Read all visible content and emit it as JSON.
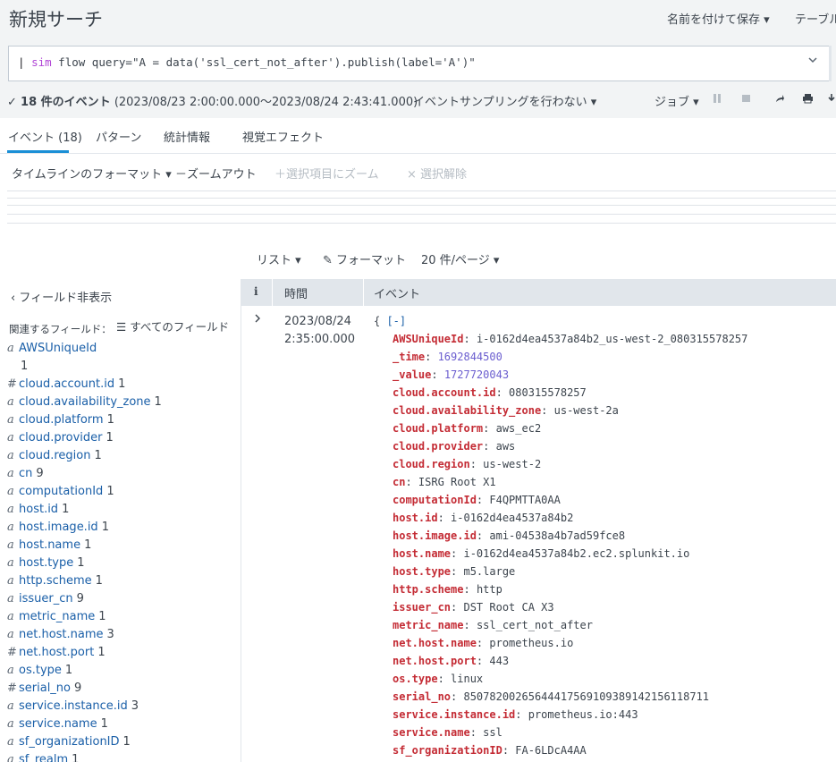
{
  "header": {
    "title": "新規サーチ",
    "save_as": "名前を付けて保存 ▾",
    "table": "テーブル"
  },
  "search": {
    "pipe": "|",
    "command": "sim",
    "rest": " flow query=\"A = data('ssl_cert_not_after').publish(label='A')\""
  },
  "status": {
    "count": "18 件のイベント",
    "range": "(2023/08/23 2:00:00.000〜2023/08/24 2:43:41.000)",
    "sampling": "イベントサンプリングを行わない ▾",
    "job": "ジョブ ▾"
  },
  "tabs": [
    {
      "label": "イベント (18)"
    },
    {
      "label": "パターン"
    },
    {
      "label": "統計情報"
    },
    {
      "label": "視覚エフェクト"
    }
  ],
  "timeline": {
    "format": "タイムラインのフォーマット ▾",
    "zoom_out": "－ズームアウト",
    "zoom_selection": "＋選択項目にズーム",
    "deselect": "× 選択解除"
  },
  "options": {
    "list": "リスト ▾",
    "format": "フォーマット",
    "per_page": "20 件/ページ ▾"
  },
  "sidebar": {
    "hide_fields": "フィールド非表示",
    "related_label": "関連するフィールド：",
    "all_fields": "すべてのフィールド",
    "fields": [
      {
        "type": "a",
        "name": "AWSUniqueId",
        "count": "1",
        "wrap": true
      },
      {
        "type": "#",
        "name": "cloud.account.id",
        "count": "1"
      },
      {
        "type": "a",
        "name": "cloud.availability_zone",
        "count": "1"
      },
      {
        "type": "a",
        "name": "cloud.platform",
        "count": "1"
      },
      {
        "type": "a",
        "name": "cloud.provider",
        "count": "1"
      },
      {
        "type": "a",
        "name": "cloud.region",
        "count": "1"
      },
      {
        "type": "a",
        "name": "cn",
        "count": "9"
      },
      {
        "type": "a",
        "name": "computationId",
        "count": "1"
      },
      {
        "type": "a",
        "name": "host.id",
        "count": "1"
      },
      {
        "type": "a",
        "name": "host.image.id",
        "count": "1"
      },
      {
        "type": "a",
        "name": "host.name",
        "count": "1"
      },
      {
        "type": "a",
        "name": "host.type",
        "count": "1"
      },
      {
        "type": "a",
        "name": "http.scheme",
        "count": "1"
      },
      {
        "type": "a",
        "name": "issuer_cn",
        "count": "9"
      },
      {
        "type": "a",
        "name": "metric_name",
        "count": "1"
      },
      {
        "type": "a",
        "name": "net.host.name",
        "count": "3"
      },
      {
        "type": "#",
        "name": "net.host.port",
        "count": "1"
      },
      {
        "type": "a",
        "name": "os.type",
        "count": "1"
      },
      {
        "type": "#",
        "name": "serial_no",
        "count": "9"
      },
      {
        "type": "a",
        "name": "service.instance.id",
        "count": "3"
      },
      {
        "type": "a",
        "name": "service.name",
        "count": "1"
      },
      {
        "type": "a",
        "name": "sf_organizationID",
        "count": "1"
      },
      {
        "type": "a",
        "name": "sf_realm",
        "count": "1"
      }
    ]
  },
  "table": {
    "col_info": "i",
    "col_time": "時間",
    "col_event": "イベント"
  },
  "event": {
    "date": "2023/08/24",
    "time": "2:35:00.000",
    "open": "{ ",
    "toggle": "[-]",
    "pairs": [
      {
        "k": "AWSUniqueId",
        "v": "i-0162d4ea4537a84b2_us-west-2_080315578257",
        "num": false
      },
      {
        "k": "_time",
        "v": "1692844500",
        "num": true
      },
      {
        "k": "_value",
        "v": "1727720043",
        "num": true
      },
      {
        "k": "cloud.account.id",
        "v": "080315578257",
        "num": false
      },
      {
        "k": "cloud.availability_zone",
        "v": "us-west-2a",
        "num": false
      },
      {
        "k": "cloud.platform",
        "v": "aws_ec2",
        "num": false
      },
      {
        "k": "cloud.provider",
        "v": "aws",
        "num": false
      },
      {
        "k": "cloud.region",
        "v": "us-west-2",
        "num": false
      },
      {
        "k": "cn",
        "v": "ISRG Root X1",
        "num": false
      },
      {
        "k": "computationId",
        "v": "F4QPMTTA0AA",
        "num": false
      },
      {
        "k": "host.id",
        "v": "i-0162d4ea4537a84b2",
        "num": false
      },
      {
        "k": "host.image.id",
        "v": "ami-04538a4b7ad59fce8",
        "num": false
      },
      {
        "k": "host.name",
        "v": "i-0162d4ea4537a84b2.ec2.splunkit.io",
        "num": false
      },
      {
        "k": "host.type",
        "v": "m5.large",
        "num": false
      },
      {
        "k": "http.scheme",
        "v": "http",
        "num": false
      },
      {
        "k": "issuer_cn",
        "v": "DST Root CA X3",
        "num": false
      },
      {
        "k": "metric_name",
        "v": "ssl_cert_not_after",
        "num": false
      },
      {
        "k": "net.host.name",
        "v": "prometheus.io",
        "num": false
      },
      {
        "k": "net.host.port",
        "v": "443",
        "num": false
      },
      {
        "k": "os.type",
        "v": "linux",
        "num": false
      },
      {
        "k": "serial_no",
        "v": "85078200265644417569109389142156118711",
        "num": false
      },
      {
        "k": "service.instance.id",
        "v": "prometheus.io:443",
        "num": false
      },
      {
        "k": "service.name",
        "v": "ssl",
        "num": false
      },
      {
        "k": "sf_organizationID",
        "v": "FA-6LDcA4AA",
        "num": false
      }
    ]
  },
  "colors": {
    "accent": "#1a8fd6",
    "json_key": "#c42c35",
    "json_number": "#6b5ecf",
    "field_name": "#1a5fa8"
  }
}
